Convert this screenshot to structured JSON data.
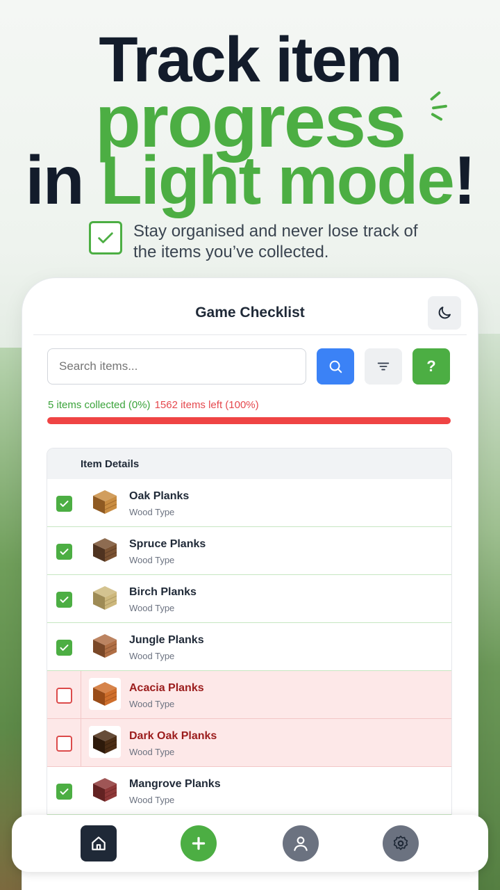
{
  "hero": {
    "line1": "Track item",
    "line2": "progress",
    "line3_a": "in ",
    "line3_b": "Light mode",
    "line3_c": "!",
    "tagline": "Stay organised and never lose track of the items you’ve collected."
  },
  "app": {
    "title": "Game Checklist",
    "search_placeholder": "Search items...",
    "help_label": "?",
    "collected_text": "5 items collected (0%)",
    "left_text": "1562 items left (100%)",
    "progress_collected_fraction": 0.0,
    "table_header": "Item Details",
    "items": [
      {
        "name": "Oak Planks",
        "type": "Wood Type",
        "checked": true,
        "color": "#c98d42",
        "dark": "#8f5a22"
      },
      {
        "name": "Spruce Planks",
        "type": "Wood Type",
        "checked": true,
        "color": "#7a5232",
        "dark": "#4f3320"
      },
      {
        "name": "Birch Planks",
        "type": "Wood Type",
        "checked": true,
        "color": "#cdb87d",
        "dark": "#9e8b55"
      },
      {
        "name": "Jungle Planks",
        "type": "Wood Type",
        "checked": true,
        "color": "#b06f45",
        "dark": "#7a4828"
      },
      {
        "name": "Acacia Planks",
        "type": "Wood Type",
        "checked": false,
        "color": "#cf6f2c",
        "dark": "#994c18"
      },
      {
        "name": "Dark Oak Planks",
        "type": "Wood Type",
        "checked": false,
        "color": "#4b2d15",
        "dark": "#2e1a0b"
      },
      {
        "name": "Mangrove Planks",
        "type": "Wood Type",
        "checked": true,
        "color": "#8e3838",
        "dark": "#632222"
      }
    ]
  },
  "nav": {
    "items": [
      "home-icon",
      "plus-icon",
      "user-icon",
      "gear-icon"
    ]
  },
  "colors": {
    "accent_green": "#4cae43",
    "accent_blue": "#3b82f6",
    "danger_red": "#ef4444",
    "text_dark": "#131c2b"
  }
}
